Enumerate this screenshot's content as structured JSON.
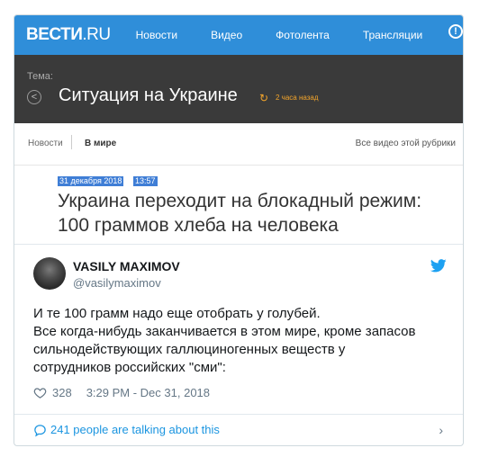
{
  "site": {
    "logo_main": "ВЕСТИ",
    "logo_suffix": ".RU",
    "nav": [
      "Новости",
      "Видео",
      "Фотолента",
      "Трансляции"
    ]
  },
  "theme": {
    "label": "Тема:",
    "title": "Ситуация на Украине",
    "updated": "2 часа назад"
  },
  "breadcrumbs": {
    "section": "Новости",
    "subsection": "В мире",
    "all_videos": "Все видео этой рубрики"
  },
  "article": {
    "date": "31 декабря 2018",
    "time": "13:57",
    "headline_line1": "Украина переходит на блокадный режим:",
    "headline_line2": "100 граммов хлеба на человека"
  },
  "tweet": {
    "author_name": "VASILY MAXIMOV",
    "author_handle": "@vasilymaximov",
    "text_lines": [
      "И те 100 грамм надо еще отобрать у голубей.",
      "Все когда-нибудь заканчивается в этом мире, кроме запасов",
      "сильнодействующих галлюциногенных веществ у",
      "сотрудников российских \"сми\":"
    ],
    "likes": "328",
    "timestamp": "3:29 PM - Dec 31, 2018",
    "talking": "241 people are talking about this"
  },
  "colors": {
    "vesti_blue": "#2f8ed9",
    "theme_bar": "#3a3a3a",
    "accent_orange": "#f3a52b",
    "twitter_blue": "#1da1f2",
    "link_blue": "#1b95e0"
  },
  "icons": [
    "info-icon",
    "back-icon",
    "refresh-icon",
    "twitter-bird-icon",
    "heart-icon",
    "speech-bubble-icon",
    "chevron-right-icon"
  ]
}
